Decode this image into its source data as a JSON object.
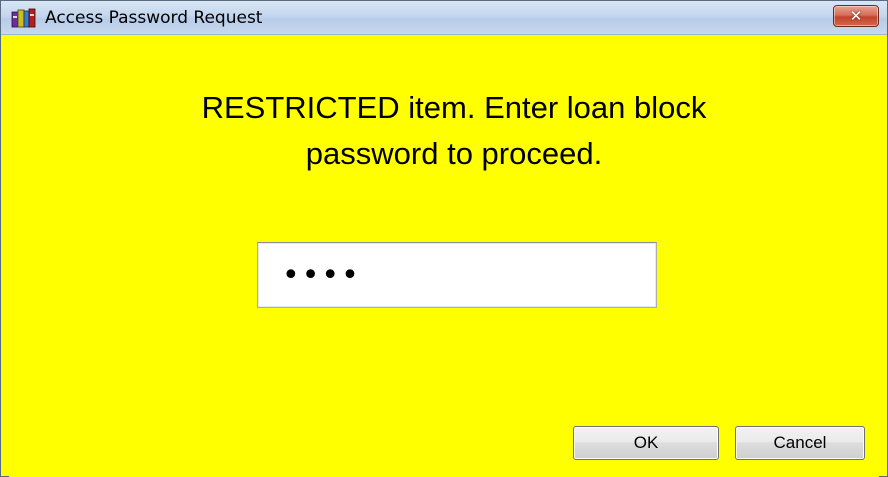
{
  "window": {
    "title": "Access Password Request",
    "icon": "books-icon",
    "close_glyph": "✕"
  },
  "dialog": {
    "message_line1": "RESTRICTED item. Enter loan block",
    "message_line2": "password to proceed.",
    "password_value": "abcd"
  },
  "buttons": {
    "ok_label": "OK",
    "cancel_label": "Cancel"
  },
  "colors": {
    "background": "#ffff00",
    "titlebar": "#c4d6ee",
    "close_button": "#c3442c"
  }
}
